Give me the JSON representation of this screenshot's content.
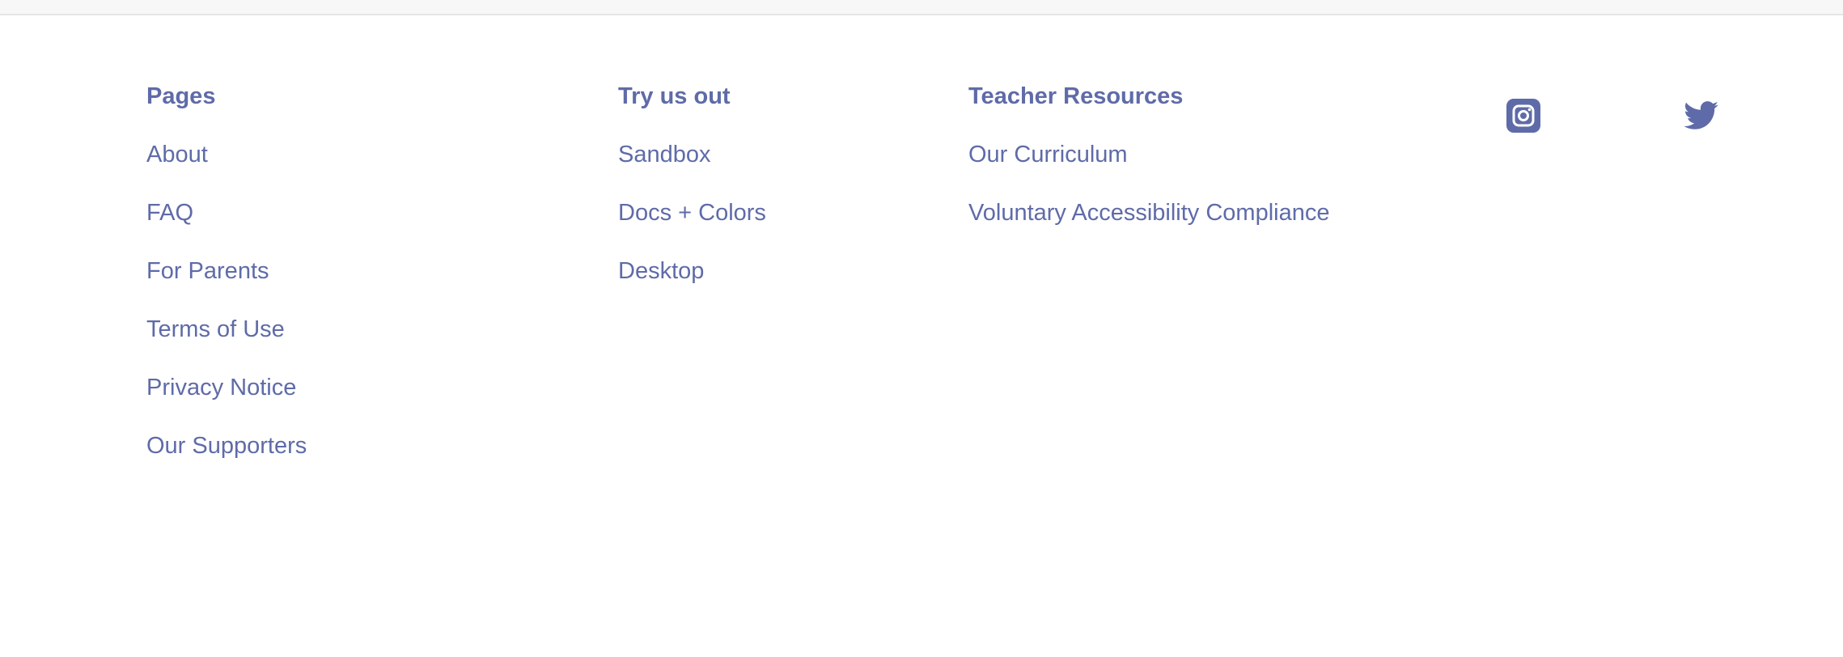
{
  "footer": {
    "columns": [
      {
        "heading": "Pages",
        "links": [
          "About",
          "FAQ",
          "For Parents",
          "Terms of Use",
          "Privacy Notice",
          "Our Supporters"
        ]
      },
      {
        "heading": "Try us out",
        "links": [
          "Sandbox",
          "Docs + Colors",
          "Desktop"
        ]
      },
      {
        "heading": "Teacher Resources",
        "links": [
          "Our Curriculum",
          "Voluntary Accessibility Compliance"
        ]
      }
    ],
    "social": [
      {
        "name": "instagram",
        "icon": "instagram-icon"
      },
      {
        "name": "twitter",
        "icon": "twitter-icon"
      }
    ]
  },
  "colors": {
    "link": "#5f6ba8",
    "background": "#ffffff",
    "topbar": "#f7f7f7"
  }
}
